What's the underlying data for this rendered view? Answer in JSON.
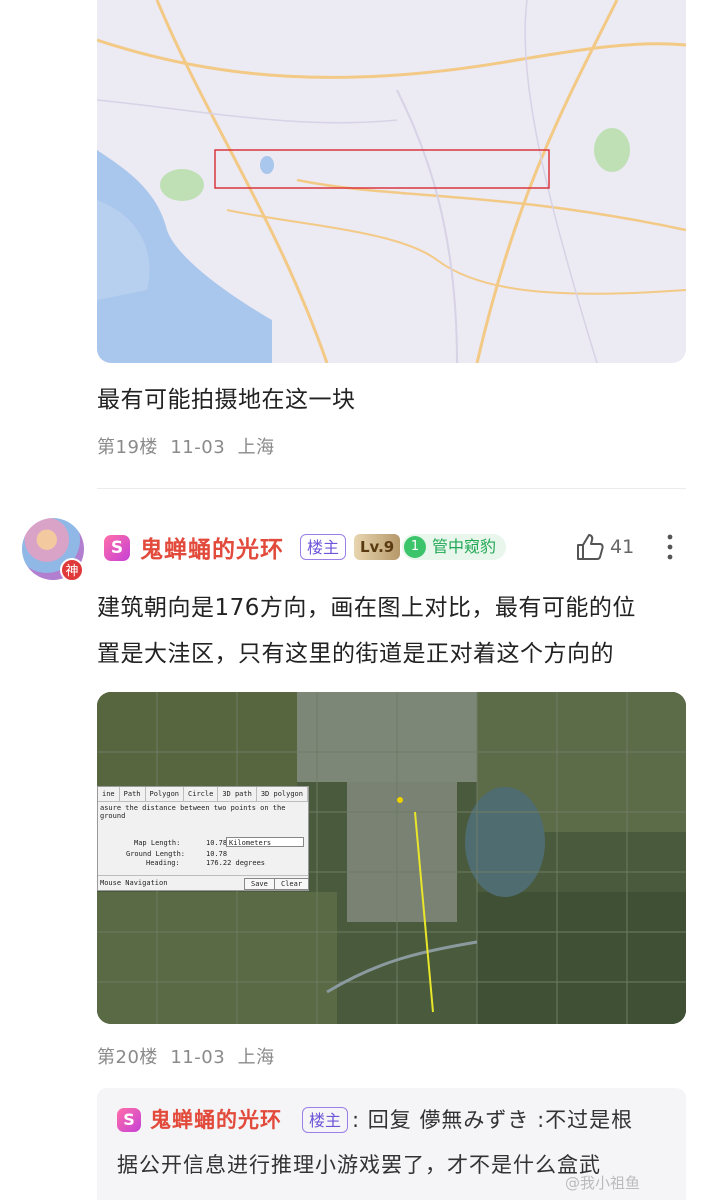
{
  "post19": {
    "text": "最有可能拍摄地在这一块",
    "floor": "第19楼",
    "date": "11-03",
    "location": "上海"
  },
  "post20": {
    "user": {
      "badge_letter": "S",
      "name": "鬼蝉蛹的光环",
      "owner_tag": "楼主",
      "level": "Lv.9",
      "rank_num": "1",
      "rank_title": "管中窥豹",
      "avatar_badge": "神"
    },
    "likes": "41",
    "text_line1": "建筑朝向是176方向，画在图上对比，最有可能的位",
    "text_line2": "置是大洼区，只有这里的街道是正对着这个方向的",
    "floor": "第20楼",
    "date": "11-03",
    "location": "上海",
    "measure_dialog": {
      "tabs": [
        "ine",
        "Path",
        "Polygon",
        "Circle",
        "3D path",
        "3D polygon"
      ],
      "description": "asure the distance between two points on the ground",
      "map_length_label": "Map Length:",
      "map_length_value": "10.78",
      "unit": "Kilometers",
      "ground_length_label": "Ground Length:",
      "ground_length_value": "10.78",
      "heading_label": "Heading:",
      "heading_value": "176.22 degrees",
      "mouse_nav": "Mouse Navigation",
      "save": "Save",
      "clear": "Clear"
    }
  },
  "reply": {
    "badge_letter": "S",
    "name": "鬼蝉蛹的光环",
    "owner_tag": "楼主",
    "line1": ": 回复 儚無みずき :不过是根",
    "line2": "据公开信息进行推理小游戏罢了，才不是什么盒武"
  },
  "watermark": "@我小祖鱼",
  "colors": {
    "username": "#e24a3b",
    "owner_tag": "#6e56d8",
    "rank_green": "#22a855",
    "highlight_rect": "#d9363e"
  }
}
